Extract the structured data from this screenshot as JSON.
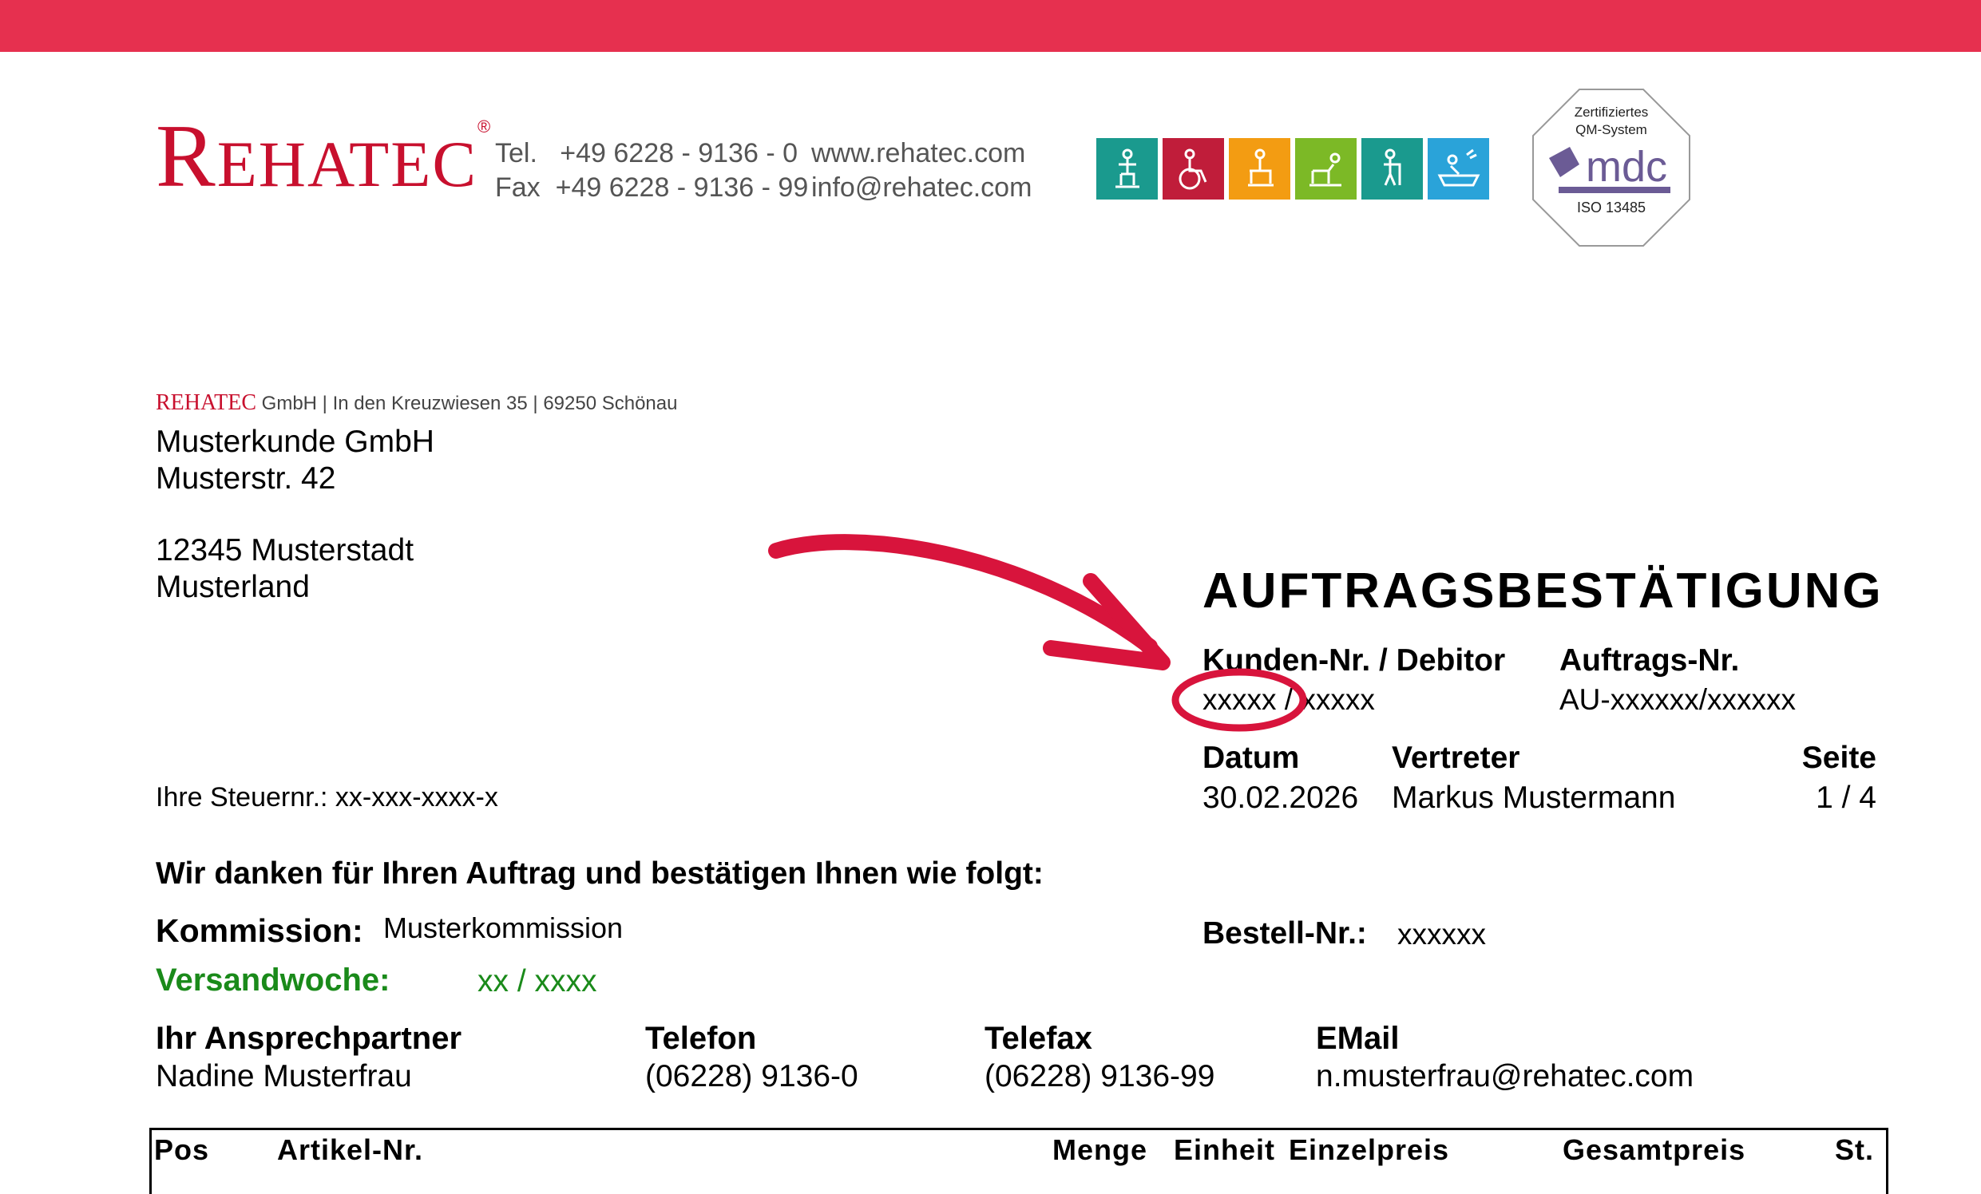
{
  "header": {
    "logo": "REHATEC",
    "tel_label": "Tel.",
    "tel": "+49 6228 - 9136 - 0",
    "fax_label": "Fax",
    "fax": "+49 6228 - 9136 - 99",
    "web": "www.rehatec.com",
    "email": "info@rehatec.com",
    "cert": {
      "line1": "Zertifiziertes",
      "line2": "QM-System",
      "brand": "mdc",
      "iso": "ISO 13485"
    },
    "category_icons": [
      {
        "icon": "standing-frame-icon",
        "color": "#1a9a8e"
      },
      {
        "icon": "wheelchair-icon",
        "color": "#c01d3a"
      },
      {
        "icon": "seat-icon",
        "color": "#f39c12"
      },
      {
        "icon": "therapy-icon",
        "color": "#7cb926"
      },
      {
        "icon": "walker-icon",
        "color": "#1a9a8e"
      },
      {
        "icon": "bath-icon",
        "color": "#2aa3d9"
      }
    ]
  },
  "sender_line": {
    "brand": "REHATEC",
    "rest": "GmbH | In den Kreuzwiesen 35 | 69250 Schönau"
  },
  "recipient": {
    "line1": "Musterkunde GmbH",
    "line2": "Musterstr. 42",
    "line3": "12345 Musterstadt",
    "line4": "Musterland"
  },
  "tax": "Ihre Steuernr.: xx-xxx-xxxx-x",
  "doc": {
    "title": "AUFTRAGSBESTÄTIGUNG",
    "kunden_label": "Kunden-Nr. / Debitor",
    "kunden_value": "xxxxx / xxxxx",
    "auftrag_label": "Auftrags-Nr.",
    "auftrag_value": "AU-xxxxxx/xxxxxx",
    "datum_label": "Datum",
    "datum_value": "30.02.2026",
    "vertreter_label": "Vertreter",
    "vertreter_value": "Markus Mustermann",
    "seite_label": "Seite",
    "seite_value": "1 / 4"
  },
  "thanks": "Wir danken für Ihren Auftrag und bestätigen Ihnen wie folgt:",
  "kommission_label": "Kommission:",
  "kommission_value": "Musterkommission",
  "bestell_label": "Bestell-Nr.:",
  "bestell_value": "xxxxxx",
  "versand_label": "Versandwoche:",
  "versand_value": "xx / xxxx",
  "contact": {
    "person_label": "Ihr Ansprechpartner",
    "person": "Nadine Musterfrau",
    "phone_label": "Telefon",
    "phone": "(06228) 9136-0",
    "fax_label": "Telefax",
    "fax": "(06228) 9136-99",
    "email_label": "EMail",
    "email": "n.musterfrau@rehatec.com"
  },
  "table_headers": {
    "pos": "Pos",
    "artikel": "Artikel-Nr.",
    "menge": "Menge",
    "einheit": "Einheit",
    "einzelpreis": "Einzelpreis",
    "gesamtpreis": "Gesamtpreis",
    "st": "St."
  },
  "colors": {
    "accent": "#e6304f",
    "brand": "#c8102e",
    "green": "#1a8a1a"
  }
}
